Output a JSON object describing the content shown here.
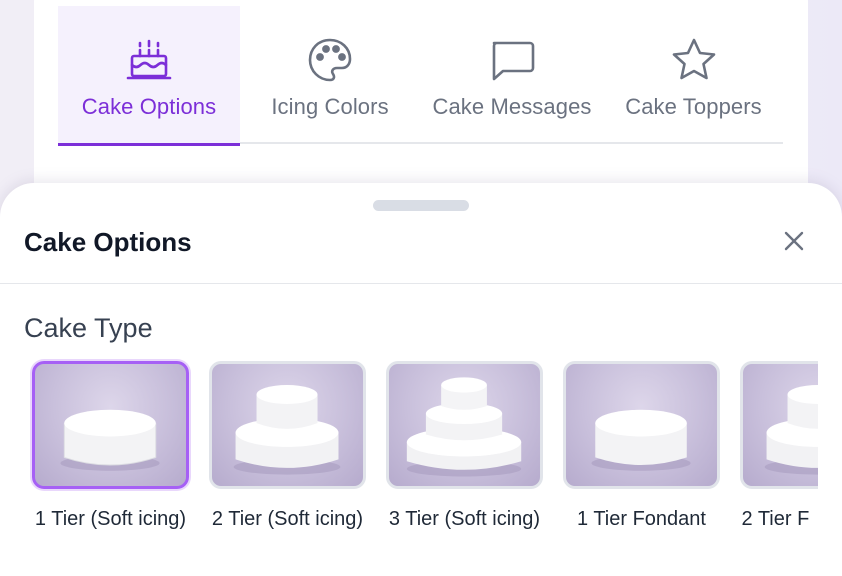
{
  "tabs": [
    {
      "label": "Cake Options",
      "icon": "cake-icon",
      "active": true
    },
    {
      "label": "Icing Colors",
      "icon": "palette-icon",
      "active": false
    },
    {
      "label": "Cake Messages",
      "icon": "message-icon",
      "active": false
    },
    {
      "label": "Cake Toppers",
      "icon": "star-icon",
      "active": false
    }
  ],
  "sheet": {
    "title": "Cake Options",
    "section_title": "Cake Type",
    "options": [
      {
        "label": "1 Tier (Soft icing)",
        "tiers": 1,
        "selected": true
      },
      {
        "label": "2 Tier (Soft icing)",
        "tiers": 2,
        "selected": false
      },
      {
        "label": "3 Tier (Soft icing)",
        "tiers": 3,
        "selected": false
      },
      {
        "label": "1 Tier Fondant",
        "tiers": 1,
        "selected": false
      },
      {
        "label": "2 Tier F",
        "tiers": 2,
        "selected": false
      }
    ]
  },
  "colors": {
    "accent": "#7c2fd8",
    "selected_border": "#a660f5",
    "inactive_text": "#6b7280"
  }
}
